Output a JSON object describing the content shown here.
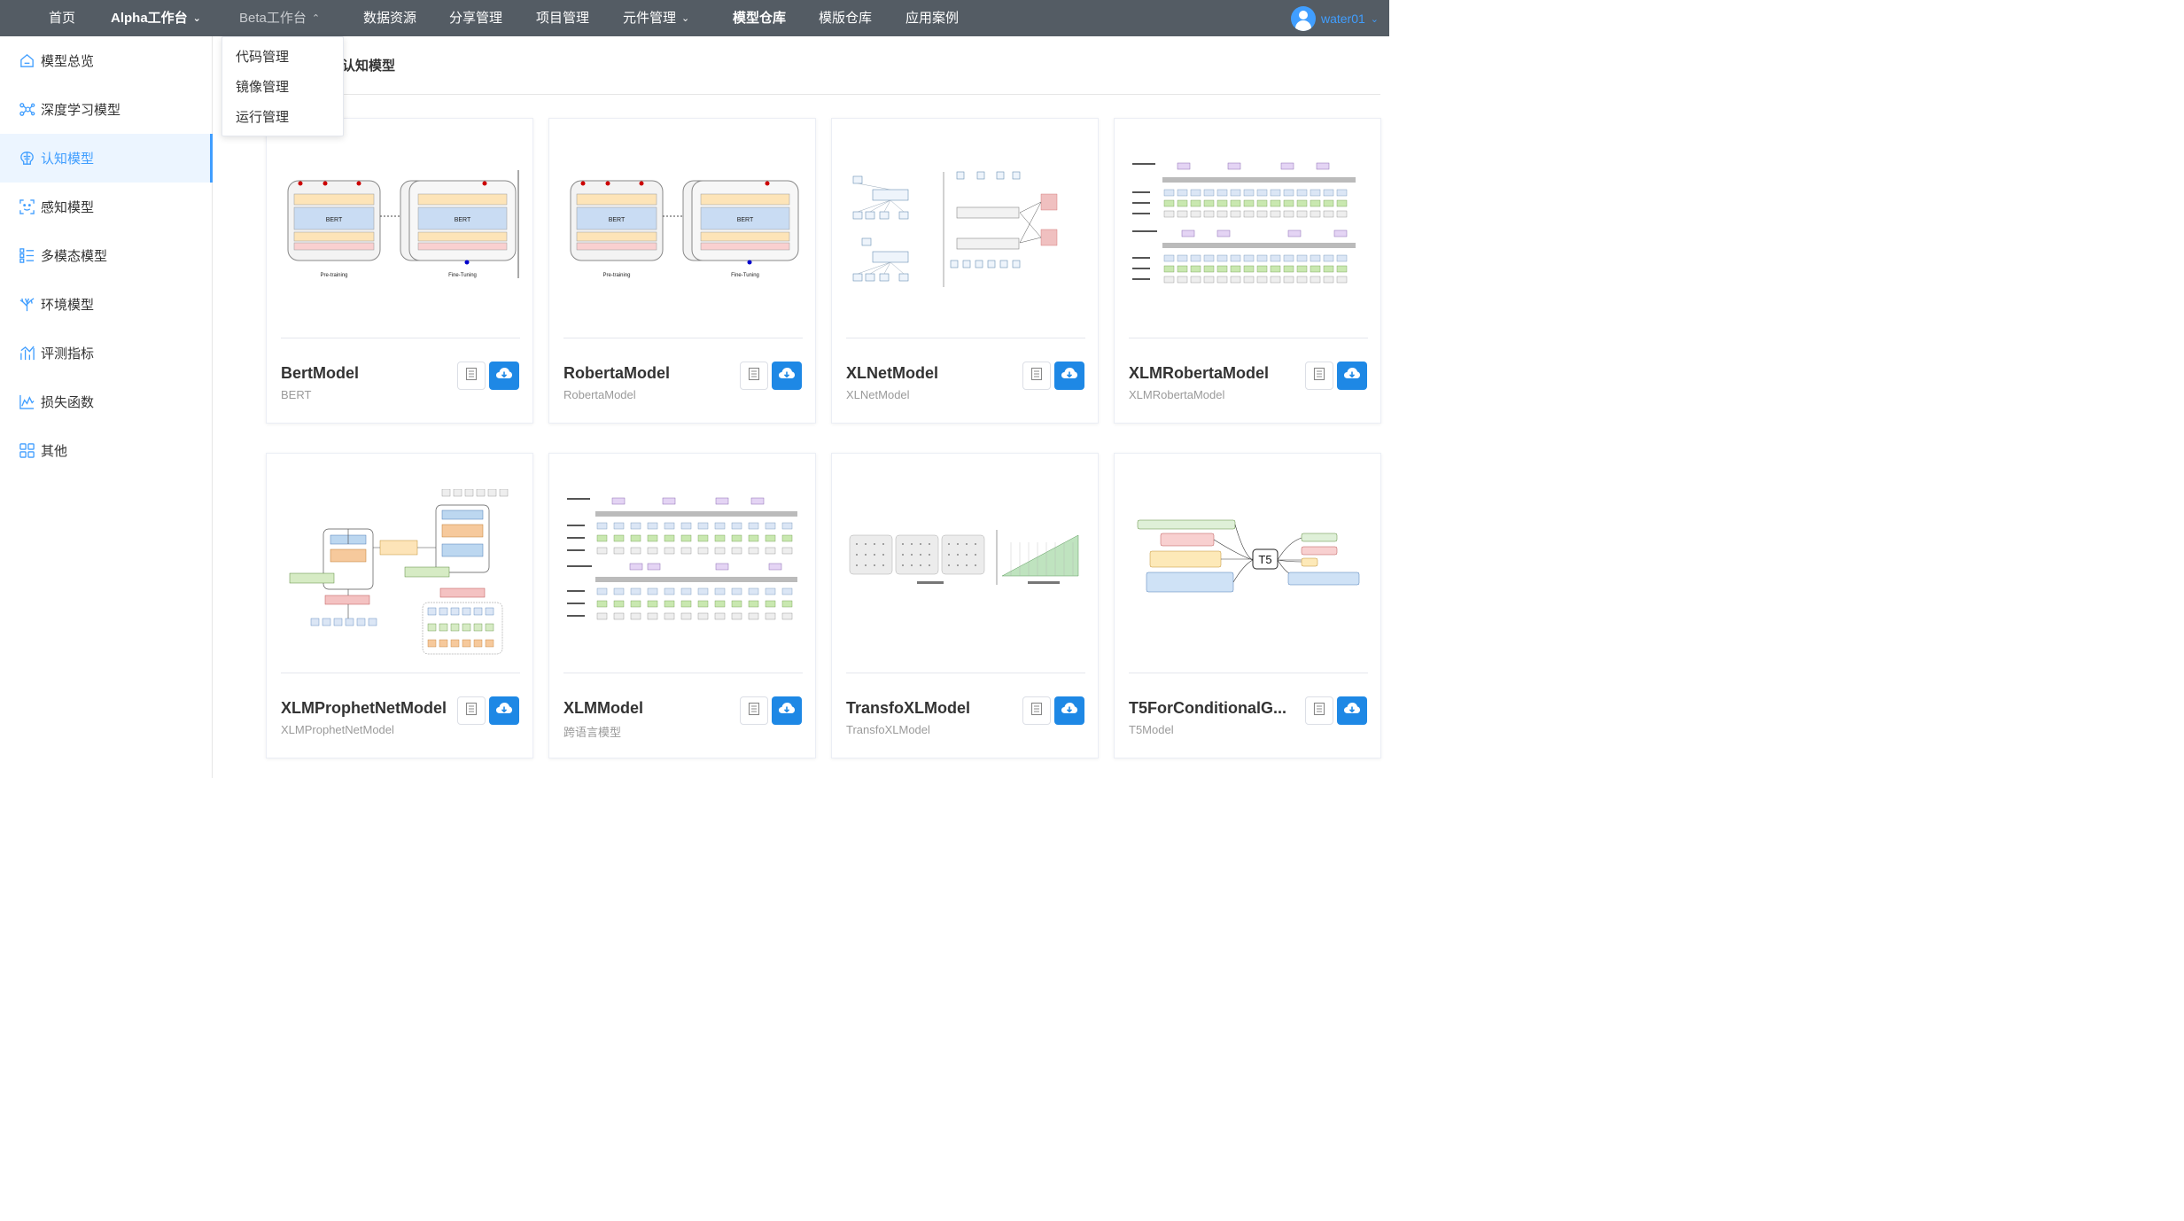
{
  "nav": {
    "items": [
      {
        "label": "首页"
      },
      {
        "label": "Alpha工作台"
      },
      {
        "label": "Beta工作台"
      },
      {
        "label": "数据资源"
      },
      {
        "label": "分享管理"
      },
      {
        "label": "项目管理"
      },
      {
        "label": "元件管理"
      },
      {
        "label": "模型仓库"
      },
      {
        "label": "模版仓库"
      },
      {
        "label": "应用案例"
      }
    ],
    "user": "water01"
  },
  "dropdown": {
    "items": [
      "代码管理",
      "镜像管理",
      "运行管理"
    ]
  },
  "sidebar": {
    "items": [
      {
        "label": "模型总览",
        "icon": "home-icon"
      },
      {
        "label": "深度学习模型",
        "icon": "network-icon"
      },
      {
        "label": "认知模型",
        "icon": "brain-icon"
      },
      {
        "label": "感知模型",
        "icon": "face-scan-icon"
      },
      {
        "label": "多模态模型",
        "icon": "list-icon"
      },
      {
        "label": "环境模型",
        "icon": "tree-icon"
      },
      {
        "label": "评测指标",
        "icon": "chart-icon"
      },
      {
        "label": "损失函数",
        "icon": "area-chart-icon"
      },
      {
        "label": "其他",
        "icon": "grid-icon"
      }
    ],
    "active": "认知模型"
  },
  "main": {
    "section_title": "认知模型",
    "cards": [
      {
        "title": "BertModel",
        "subtitle": "BERT"
      },
      {
        "title": "RobertaModel",
        "subtitle": "RobertaModel"
      },
      {
        "title": "XLNetModel",
        "subtitle": "XLNetModel"
      },
      {
        "title": "XLMRobertaModel",
        "subtitle": "XLMRobertaModel"
      },
      {
        "title": "XLMProphetNetModel",
        "subtitle": "XLMProphetNetModel"
      },
      {
        "title": "XLMModel",
        "subtitle": "跨语言模型"
      },
      {
        "title": "TransfoXLModel",
        "subtitle": "TransfoXLModel"
      },
      {
        "title": "T5ForConditionalG...",
        "subtitle": "T5Model"
      }
    ]
  },
  "colors": {
    "nav_bg": "#545c64",
    "accent": "#409eff",
    "download_btn": "#1e88e5"
  }
}
